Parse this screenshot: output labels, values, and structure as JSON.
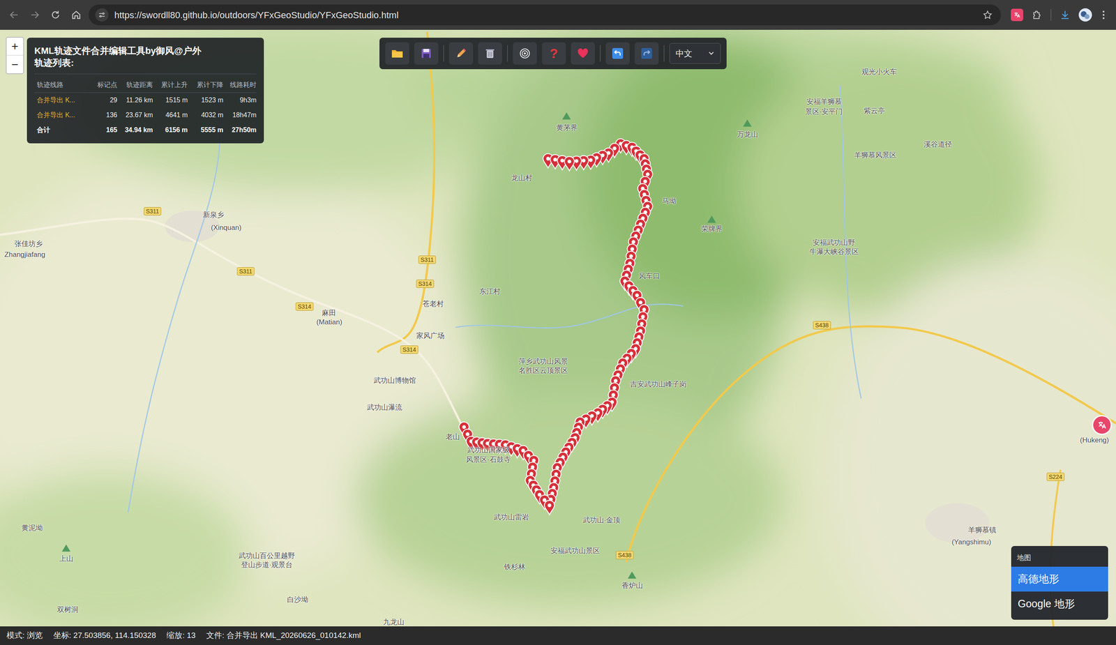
{
  "browser": {
    "url": "https://swordll80.github.io/outdoors/YFxGeoStudio/YFxGeoStudio.html"
  },
  "zoom_controls": [
    "+",
    "−"
  ],
  "info_panel": {
    "title": "KML轨迹文件合并编辑工具by御风@户外",
    "subtitle": "轨迹列表:",
    "table": {
      "columns": [
        "轨迹线路",
        "标记点",
        "轨迹距离",
        "累计上升",
        "累计下降",
        "线路耗时"
      ],
      "rows": [
        {
          "kind": "track",
          "cells": [
            "合并导出 K...",
            "29",
            "11.26 km",
            "1515 m",
            "1523 m",
            "9h3m"
          ]
        },
        {
          "kind": "track",
          "cells": [
            "合并导出 K...",
            "136",
            "23.67 km",
            "4641 m",
            "4032 m",
            "18h47m"
          ]
        },
        {
          "kind": "total",
          "cells": [
            "合计",
            "165",
            "34.94 km",
            "6156 m",
            "5555 m",
            "27h50m"
          ]
        }
      ]
    }
  },
  "toolbar": {
    "help_label": "?",
    "language": "中文"
  },
  "map": {
    "labels": [
      "黄茅界",
      "龙山村",
      "马坳",
      "荣牌界",
      "风车口",
      "萍乡武功山风景",
      "名胜区云顶景区",
      "吉安武功山峰子岗",
      "武功山国家级",
      "风景区·石鼓寺",
      "武功山雷岩",
      "武功山·金顶",
      "安福武功山景区",
      "武功山百公里越野",
      "登山步道·观景台",
      "新泉乡",
      "(Xinquan)",
      "张佳坊乡",
      "Zhangjiafang",
      "麻田",
      "(Matian)",
      "家风广场",
      "武功山博物馆",
      "武功山瀑流",
      "东江村",
      "苍老村",
      "万龙山",
      "观光小火车",
      "安福羊狮慕",
      "景区·安平门",
      "紫云亭",
      "溪谷道径",
      "羊狮慕风景区",
      "安福武功山野",
      "牛瀑大峡谷景区",
      "羊狮慕镇",
      "(Yangshimu)",
      "香炉山",
      "黄泥坳",
      "上山",
      "双树洞",
      "白沙坳",
      "九龙山",
      "铁杉林",
      "(Hukeng)",
      "老山"
    ],
    "road_shields": [
      "S311",
      "S311",
      "S311",
      "S314",
      "S314",
      "S314",
      "S438",
      "S438",
      "S224"
    ]
  },
  "layer_panel": {
    "title": "地图",
    "options": [
      {
        "label": "高德地形",
        "selected": true
      },
      {
        "label": "Google 地形",
        "selected": false
      }
    ]
  },
  "status_bar": {
    "mode": "模式: 浏览",
    "coords": "坐标: 27.503856, 114.150328",
    "zoom": "缩放: 13",
    "file": "文件: 合并导出 KML_20260626_010142.kml"
  }
}
